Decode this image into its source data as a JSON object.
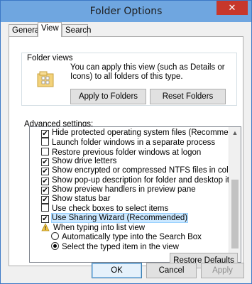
{
  "window": {
    "title": "Folder Options",
    "close_glyph": "✕"
  },
  "tabs": [
    {
      "label": "General"
    },
    {
      "label": "View"
    },
    {
      "label": "Search"
    }
  ],
  "folder_views": {
    "group_label": "Folder views",
    "description": "You can apply this view (such as Details or Icons) to all folders of this type.",
    "apply_button": "Apply to Folders",
    "reset_button": "Reset Folders",
    "icon": "folder-views-icon"
  },
  "advanced": {
    "label": "Advanced settings:",
    "items": [
      {
        "type": "checkbox",
        "checked": true,
        "label": "Hide protected operating system files (Recommended)"
      },
      {
        "type": "checkbox",
        "checked": false,
        "label": "Launch folder windows in a separate process"
      },
      {
        "type": "checkbox",
        "checked": false,
        "label": "Restore previous folder windows at logon"
      },
      {
        "type": "checkbox",
        "checked": true,
        "label": "Show drive letters"
      },
      {
        "type": "checkbox",
        "checked": true,
        "label": "Show encrypted or compressed NTFS files in color"
      },
      {
        "type": "checkbox",
        "checked": true,
        "label": "Show pop-up description for folder and desktop items"
      },
      {
        "type": "checkbox",
        "checked": true,
        "label": "Show preview handlers in preview pane"
      },
      {
        "type": "checkbox",
        "checked": true,
        "label": "Show status bar"
      },
      {
        "type": "checkbox",
        "checked": false,
        "label": "Use check boxes to select items"
      },
      {
        "type": "checkbox",
        "checked": true,
        "label": "Use Sharing Wizard (Recommended)",
        "selected": true
      },
      {
        "type": "group",
        "label": "When typing into list view"
      },
      {
        "type": "radio",
        "checked": false,
        "label": "Automatically type into the Search Box"
      },
      {
        "type": "radio",
        "checked": true,
        "label": "Select the typed item in the view"
      }
    ],
    "restore_button": "Restore Defaults"
  },
  "footer": {
    "ok": "OK",
    "cancel": "Cancel",
    "apply": "Apply"
  },
  "colors": {
    "titlebar": "#6fa6e0",
    "close": "#c7372b",
    "selection": "#cce8ff"
  }
}
